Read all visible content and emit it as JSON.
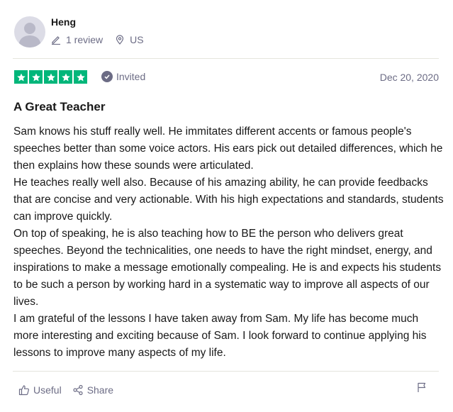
{
  "reviewer": {
    "name": "Heng",
    "reviews": "1 review",
    "country": "US",
    "avatar_icon": "user-avatar-icon",
    "reviews_icon": "pencil-icon",
    "location_icon": "location-pin-icon"
  },
  "rating": {
    "stars": 5,
    "max_stars": 5,
    "star_color": "#00b67a",
    "invited_label": "Invited",
    "invited_icon": "check-circle-icon",
    "date": "Dec 20, 2020"
  },
  "review": {
    "title": "A Great Teacher",
    "paragraphs": [
      "Sam knows his stuff really well. He immitates different accents or famous people's speeches better than some voice actors. His ears pick out detailed differences, which he then explains how these sounds were articulated.",
      "He teaches really well also. Because of his amazing ability, he can provide feedbacks that are concise and very actionable. With his high expectations and standards, students can improve quickly.",
      "On top of speaking, he is also teaching how to BE the person who delivers great speeches. Beyond the technicalities, one needs to have the right mindset, energy, and inspirations to make a message emotionally compealing. He is and expects his students to be such a person by working hard in a systematic way to improve all aspects of our lives.",
      "I am grateful of the lessons I have taken away from Sam. My life has become much more interesting and exciting because of Sam. I look forward to continue applying his lessons to improve many aspects of my life."
    ]
  },
  "actions": {
    "useful_label": "Useful",
    "share_label": "Share",
    "useful_icon": "thumbs-up-icon",
    "share_icon": "share-icon",
    "flag_icon": "flag-icon"
  }
}
